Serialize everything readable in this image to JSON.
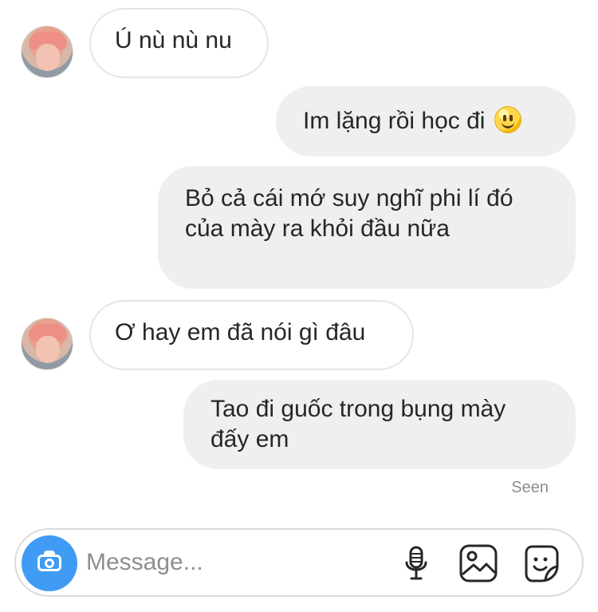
{
  "messages": [
    {
      "direction": "incoming",
      "text": "Ú nù nù nu",
      "has_avatar": true
    },
    {
      "direction": "outgoing",
      "text": "Im lặng rồi học đi",
      "emoji": "slightly-smiling-face-icon"
    },
    {
      "direction": "outgoing",
      "text": "Bỏ cả cái mớ suy nghĩ phi lí đó của mày ra khỏi đầu nữa"
    },
    {
      "direction": "incoming",
      "text": "Ơ hay em đã nói gì đâu",
      "has_avatar": true
    },
    {
      "direction": "outgoing",
      "text": "Tao đi guốc trong bụng mày đấy em"
    }
  ],
  "status": {
    "seen": "Seen"
  },
  "composer": {
    "placeholder": "Message...",
    "value": "",
    "icons": [
      "camera-icon",
      "microphone-icon",
      "gallery-icon",
      "sticker-icon"
    ]
  },
  "colors": {
    "incoming_bubble_border": "#e5e5e5",
    "outgoing_bubble": "#efefef",
    "camera_button": "#3f9bf4",
    "muted_text": "#8e8e8e"
  }
}
